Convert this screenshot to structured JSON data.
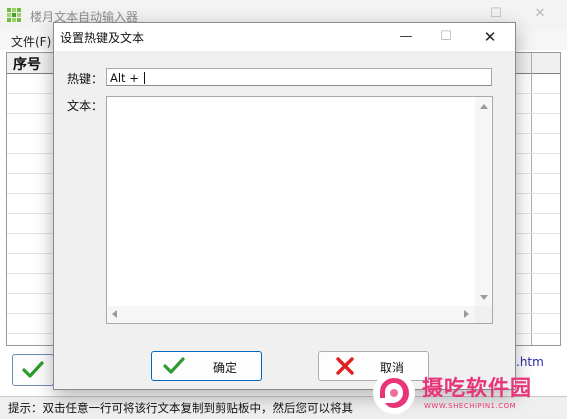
{
  "main_window": {
    "title": "楼月文本自动输入器",
    "menu": {
      "file": "文件(F)"
    },
    "grid_header": {
      "seq": "序号"
    },
    "link_fragment": ".htm"
  },
  "status_bar": {
    "text": "提示：双击任意一行可将该行文本复制到剪贴板中，然后您可以将其"
  },
  "dialog": {
    "title": "设置热键及文本",
    "hotkey_label": "热键：",
    "hotkey_value": "Alt + ",
    "text_label": "文本：",
    "text_value": "",
    "ok_label": "确定",
    "cancel_label": "取消"
  },
  "watermark": {
    "brand": "摄吃软件园",
    "url": "WWW.SHECHIPIN1.COM"
  },
  "colors": {
    "accent": "#0067c0",
    "ok_check": "#2e9b2e",
    "cancel_x": "#e02020",
    "brand_pink": "#e8357a"
  },
  "icons": [
    "app-icon",
    "minimize-icon",
    "maximize-icon",
    "close-icon",
    "check-icon",
    "x-icon",
    "logo-icon"
  ]
}
